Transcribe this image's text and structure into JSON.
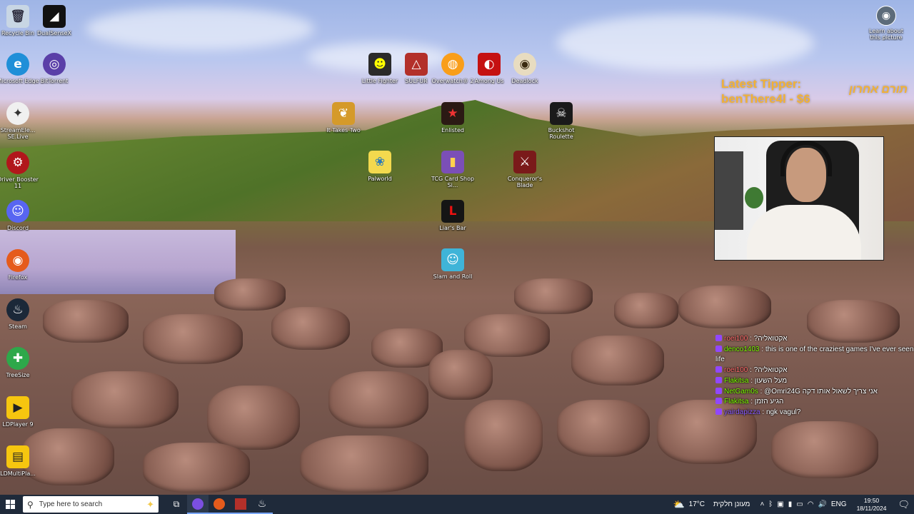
{
  "desktop_icons": [
    {
      "label": "Recycle Bin",
      "icon": "recycle-bin-icon",
      "color": "#c8d6e4",
      "glyph": "🗑"
    },
    {
      "label": "DualSenseX",
      "icon": "dualsensex-icon",
      "color": "#111111",
      "glyph": "◢"
    },
    {
      "label": "Microsoft Edge",
      "icon": "edge-icon",
      "color": "#1f8fd8",
      "glyph": "e"
    },
    {
      "label": "BitTorrent",
      "icon": "bittorrent-icon",
      "color": "#5a3fa8",
      "glyph": "◎"
    },
    {
      "label": "StreamEle... SE.Live",
      "icon": "streamelements-icon",
      "color": "#f0f0f0",
      "glyph": "✦"
    },
    {
      "label": "Driver Booster 11",
      "icon": "driver-booster-icon",
      "color": "#b1171b",
      "glyph": "⚙"
    },
    {
      "label": "Discord",
      "icon": "discord-icon",
      "color": "#5865f2",
      "glyph": "☺"
    },
    {
      "label": "Firefox",
      "icon": "firefox-icon",
      "color": "#e55b1c",
      "glyph": "◉"
    },
    {
      "label": "Steam",
      "icon": "steam-icon",
      "color": "#1b2838",
      "glyph": "♨"
    },
    {
      "label": "TreeSize",
      "icon": "treesize-icon",
      "color": "#2ea84a",
      "glyph": "✚"
    },
    {
      "label": "LDPlayer 9",
      "icon": "ldplayer-icon",
      "color": "#f6c60f",
      "glyph": "▶"
    },
    {
      "label": "LDMultiPla...",
      "icon": "ldmultiplayer-icon",
      "color": "#f6c60f",
      "glyph": "▤"
    },
    {
      "label": "Little Fighter",
      "icon": "little-fighter-icon",
      "color": "#2a2a2a",
      "glyph": "☻"
    },
    {
      "label": "SULFUR",
      "icon": "sulfur-icon",
      "color": "#b3302a",
      "glyph": "△"
    },
    {
      "label": "Overwatch® 2",
      "icon": "overwatch-icon",
      "color": "#f99e1a",
      "glyph": "◍"
    },
    {
      "label": "Among Us",
      "icon": "among-us-icon",
      "color": "#c51111",
      "glyph": "◐"
    },
    {
      "label": "Deadlock",
      "icon": "deadlock-icon",
      "color": "#e8dcc0",
      "glyph": "◉"
    },
    {
      "label": "It Takes Two",
      "icon": "it-takes-two-icon",
      "color": "#d59a2a",
      "glyph": "❦"
    },
    {
      "label": "Enlisted",
      "icon": "enlisted-icon",
      "color": "#2b1a14",
      "glyph": "★"
    },
    {
      "label": "Buckshot Roulette",
      "icon": "buckshot-roulette-icon",
      "color": "#1a1a1a",
      "glyph": "☠"
    },
    {
      "label": "Palworld",
      "icon": "palworld-icon",
      "color": "#f3d94e",
      "glyph": "❀"
    },
    {
      "label": "TCG Card Shop Si...",
      "icon": "tcg-card-shop-icon",
      "color": "#7b4fb7",
      "glyph": "▮"
    },
    {
      "label": "Conqueror's Blade",
      "icon": "conquerors-blade-icon",
      "color": "#7a1a1a",
      "glyph": "⚔"
    },
    {
      "label": "Liar's Bar",
      "icon": "liars-bar-icon",
      "color": "#151515",
      "glyph": "L"
    },
    {
      "label": "Slam and Roll",
      "icon": "slam-and-roll-icon",
      "color": "#3fb4d8",
      "glyph": "☺"
    },
    {
      "label": "Learn about this picture",
      "icon": "learn-about-picture-icon",
      "color": "#5c6b7a",
      "glyph": "◉"
    }
  ],
  "overlay": {
    "tipper_title": "Latest Tipper:",
    "tipper_value": "benThere4l - $6",
    "tipper_hebrew": "תורם אחרון"
  },
  "chat": [
    {
      "user": "roei100",
      "msg": "?אקטואליה",
      "user_color": "#ff6b6b"
    },
    {
      "user": "denco1403",
      "msg": "this is one of the craziest games I've ever seen in my",
      "user_color": "#7fff00"
    },
    {
      "user": "",
      "msg": "life",
      "user_color": "#ffffff"
    },
    {
      "user": "roei100",
      "msg": "?אקטואליה",
      "user_color": "#ff6b6b"
    },
    {
      "user": "Flakitsa",
      "msg": "מעל השעון",
      "user_color": "#7fff00"
    },
    {
      "user": "NetGam0s",
      "msg": "@Omri24G אני צריך לשאול אותו דקה",
      "user_color": "#7fff00"
    },
    {
      "user": "Flakitsa",
      "msg": "הגיע הזמן",
      "user_color": "#7fff00"
    },
    {
      "user": "yairdapizza",
      "msg": "ngk vagul?",
      "user_color": "#8a5cff"
    }
  ],
  "taskbar": {
    "search_placeholder": "Type here to search",
    "weather": "17°C",
    "weather_text": "מעונן חלקית",
    "lang": "ENG",
    "time": "19:50",
    "date": "18/11/2024"
  }
}
